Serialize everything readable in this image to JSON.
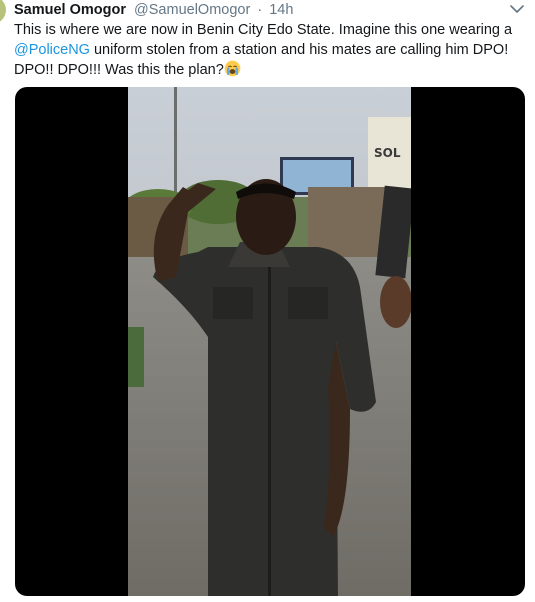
{
  "tweet": {
    "display_name": "Samuel Omogor",
    "handle": "@SamuelOmogor",
    "separator": "·",
    "time": "14h",
    "text_part1": "This is where we are now in Benin City Edo State. Imagine this one wearing a ",
    "mention": "@PoliceNG",
    "text_part2": " uniform stolen from a station and his mates are calling him DPO! DPO!! DPO!!! Was this the plan?",
    "emoji": "crying-face-emoji"
  },
  "video": {
    "billboard_text_line1": "SOL"
  },
  "colors": {
    "link": "#1b95e0",
    "secondary_text": "#657786",
    "media_background": "#000000"
  }
}
